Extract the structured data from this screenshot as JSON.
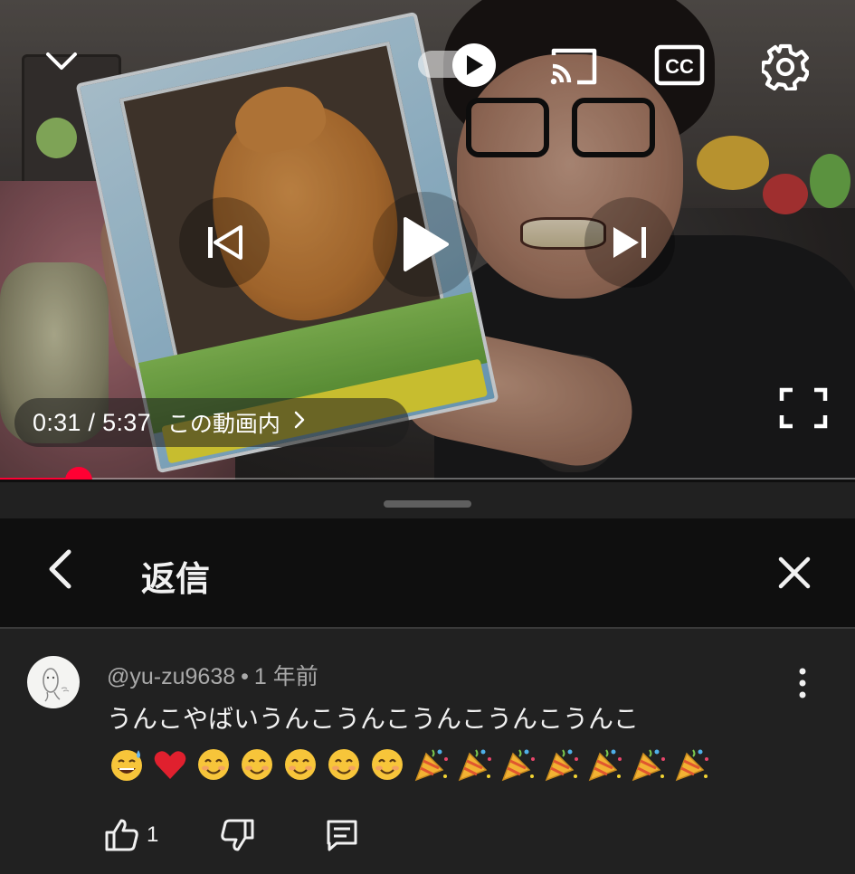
{
  "player": {
    "time": "0:31 / 5:37",
    "chapter": "この動画内",
    "progress_fraction": 0.092,
    "autoplay_on": true,
    "icons": [
      "chevron-down-icon",
      "autoplay-toggle",
      "cast-icon",
      "cc-icon",
      "gear-icon",
      "previous-icon",
      "play-icon",
      "next-icon",
      "fullscreen-icon"
    ],
    "cc_label": "CC"
  },
  "sheet": {
    "title": "返信",
    "back_icon": "chevron-left-icon",
    "close_icon": "close-icon"
  },
  "comment": {
    "author": "@yu-zu9638",
    "separator": "•",
    "age": "1 年前",
    "text": "うんこやばいうんこうんこうんこうんこうんこ",
    "emojis": [
      "😅",
      "❤️",
      "😊",
      "😊",
      "😊",
      "😊",
      "😊",
      "🎉",
      "🎉",
      "🎉",
      "🎉",
      "🎉",
      "🎉",
      "🎉"
    ],
    "like_count": "1"
  },
  "colors": {
    "accent": "#ff0033",
    "sheet_bg": "#212121",
    "header_bg": "#0f0f0f",
    "secondary_text": "#aaaaaa"
  }
}
